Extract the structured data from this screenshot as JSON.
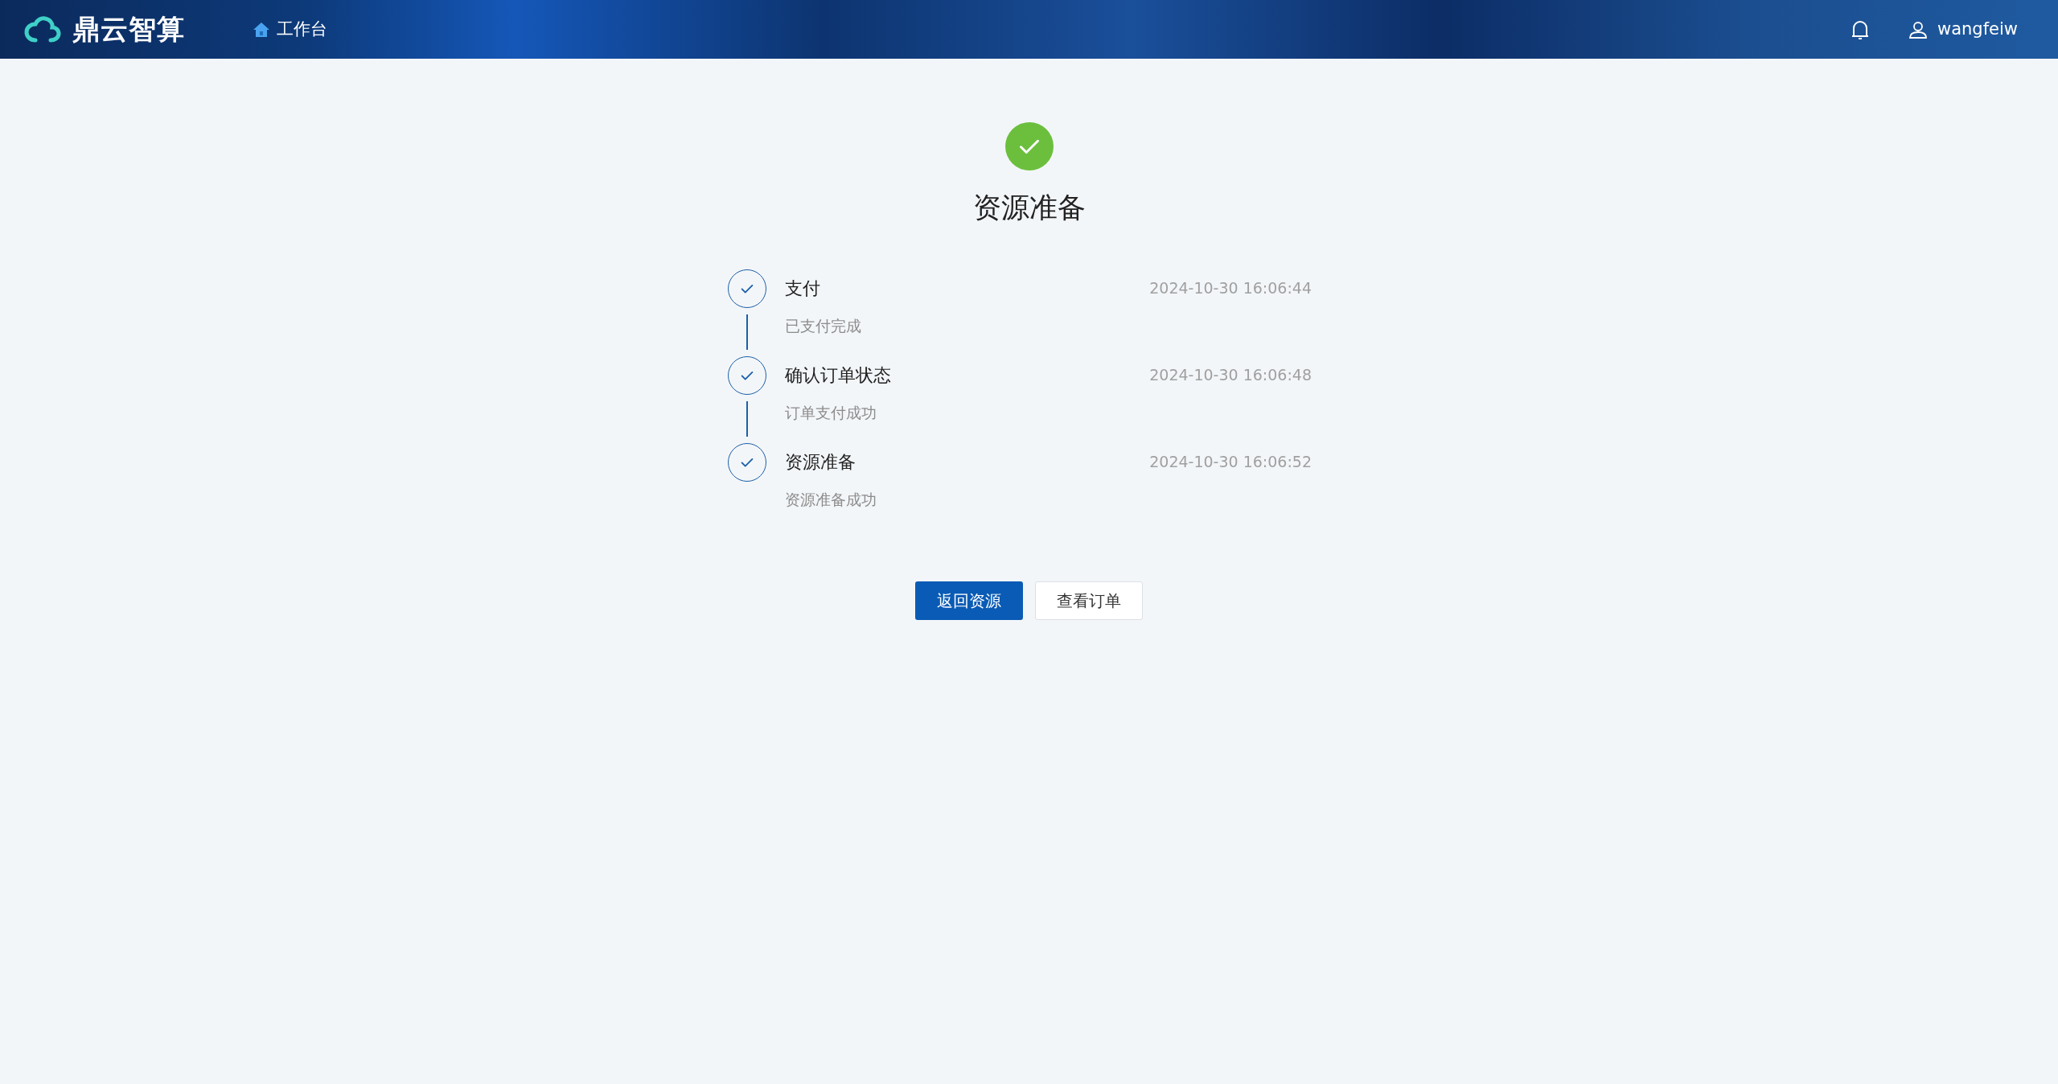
{
  "header": {
    "brand": "鼎云智算",
    "nav": {
      "label": "工作台"
    },
    "user": "wangfeiw"
  },
  "result": {
    "title": "资源准备"
  },
  "steps": [
    {
      "title": "支付",
      "description": "已支付完成",
      "time": "2024-10-30 16:06:44"
    },
    {
      "title": "确认订单状态",
      "description": "订单支付成功",
      "time": "2024-10-30 16:06:48"
    },
    {
      "title": "资源准备",
      "description": "资源准备成功",
      "time": "2024-10-30 16:06:52"
    }
  ],
  "buttons": [
    {
      "label": "返回资源",
      "kind": "primary"
    },
    {
      "label": "查看订单",
      "kind": "default"
    }
  ]
}
